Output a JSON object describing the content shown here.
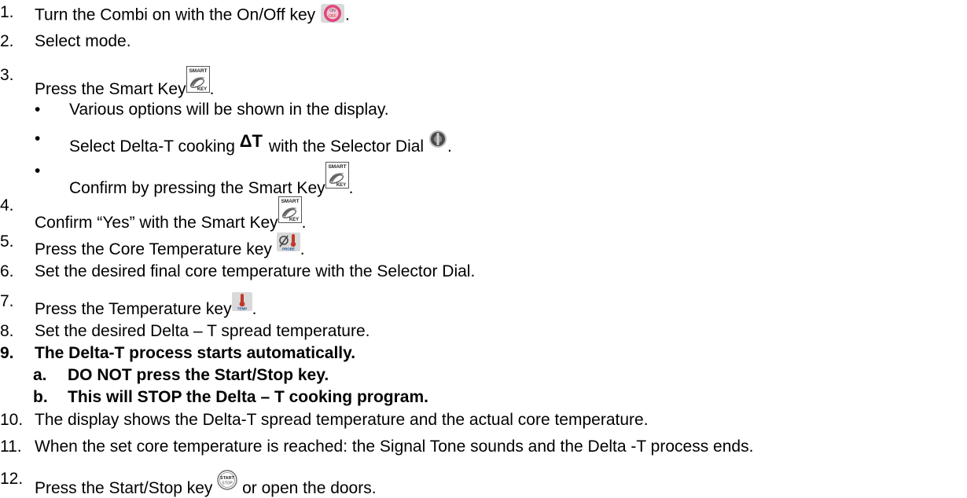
{
  "steps": [
    {
      "num": "1.",
      "pre": "Turn the Combi on with the On/Off key",
      "icon": "on-off-key-icon",
      "post": "."
    },
    {
      "num": "2.",
      "text": "Select mode."
    },
    {
      "num": "3.",
      "pre": "Press the Smart Key",
      "icon": "smart-key-icon",
      "post": "."
    },
    {
      "num": "4.",
      "pre": "Confirm “Yes” with the Smart Key",
      "icon": "smart-key-icon",
      "post": "."
    },
    {
      "num": "5.",
      "pre": "Press the Core Temperature key",
      "icon": "core-temperature-key-icon",
      "post": "."
    },
    {
      "num": "6.",
      "text": "Set the desired final core temperature with the Selector Dial."
    },
    {
      "num": "7.",
      "pre": "Press the Temperature key",
      "icon": "temperature-key-icon",
      "post": "."
    },
    {
      "num": "8.",
      "text": "Set the desired Delta – T spread temperature."
    },
    {
      "num": "9.",
      "text": "The Delta-T process starts automatically."
    },
    {
      "num": "10.",
      "text": "The display shows the Delta-T spread temperature and the actual core temperature."
    },
    {
      "num": "11.",
      "text": "When the set core temperature is reached: the Signal Tone sounds and the Delta -T process ends."
    },
    {
      "num": "12.",
      "pre": "Press the Start/Stop key",
      "icon": "start-stop-key-icon",
      "post": " or open the doors."
    }
  ],
  "step3_bullets": [
    {
      "text": "Various options will be shown in the display."
    },
    {
      "pre": "Select Delta-T cooking",
      "delta_symbol": "ΔT",
      "mid": "with the Selector Dial",
      "icon": "selector-dial-icon",
      "post": "."
    },
    {
      "pre": "Confirm by pressing the Smart Key",
      "icon": "smart-key-icon",
      "post": "."
    }
  ],
  "step9_subs": [
    {
      "letter": "a.",
      "text": "DO NOT press the Start/Stop key."
    },
    {
      "letter": "b.",
      "text": "This will STOP the Delta – T cooking program."
    }
  ],
  "icon_labels": {
    "on_top": "ON",
    "on_bottom": "OFF",
    "smart_top": "SMART",
    "smart_bottom": "KEY",
    "probe": "PROBE",
    "temp": "TEMP",
    "start_top": "START",
    "start_bottom": "STOP"
  },
  "colors": {
    "text": "#000000",
    "on_off_key": "#e0457b",
    "thermometer": "#c0392b",
    "icon_panel": "#d9d9d9"
  }
}
